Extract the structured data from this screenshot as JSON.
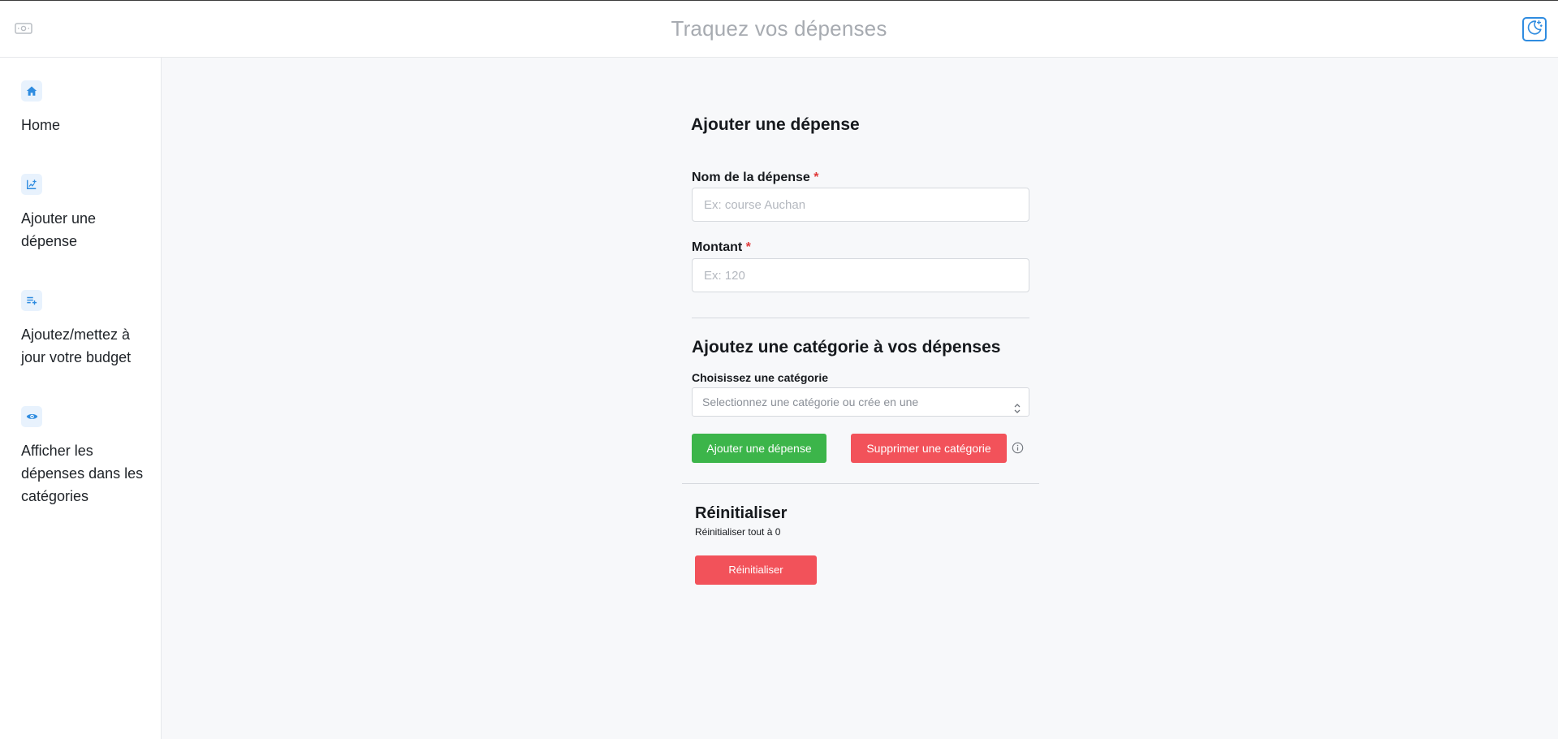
{
  "header": {
    "title": "Traquez vos dépenses",
    "logo_icon": "money-icon",
    "theme_icon": "moon-stars-icon"
  },
  "sidebar": {
    "items": [
      {
        "label": "Home",
        "icon": "home-icon"
      },
      {
        "label": "Ajouter une dépense",
        "icon": "chart-add-icon"
      },
      {
        "label": "Ajoutez/mettez à jour votre budget",
        "icon": "playlist-add-icon"
      },
      {
        "label": "Afficher les dépenses dans les catégories",
        "icon": "eye-icon"
      }
    ]
  },
  "form": {
    "title": "Ajouter une dépense",
    "name_field": {
      "label": "Nom de la dépense",
      "required_mark": "*",
      "placeholder": "Ex: course Auchan",
      "value": ""
    },
    "amount_field": {
      "label": "Montant",
      "required_mark": "*",
      "placeholder": "Ex: 120",
      "value": ""
    }
  },
  "category": {
    "title": "Ajoutez une catégorie à vos dépenses",
    "select_label": "Choisissez une catégorie",
    "select_placeholder": "Selectionnez une catégorie ou crée en une",
    "add_button": "Ajouter une dépense",
    "delete_button": "Supprimer une catégorie",
    "info_icon": "info-circle-icon"
  },
  "reset": {
    "title": "Réinitialiser",
    "subtitle": "Réinitialiser tout à 0",
    "button": "Réinitialiser"
  },
  "colors": {
    "accent": "#2f8ce0",
    "success": "#3cb54a",
    "danger": "#f2525a",
    "background": "#f7f8fa"
  }
}
